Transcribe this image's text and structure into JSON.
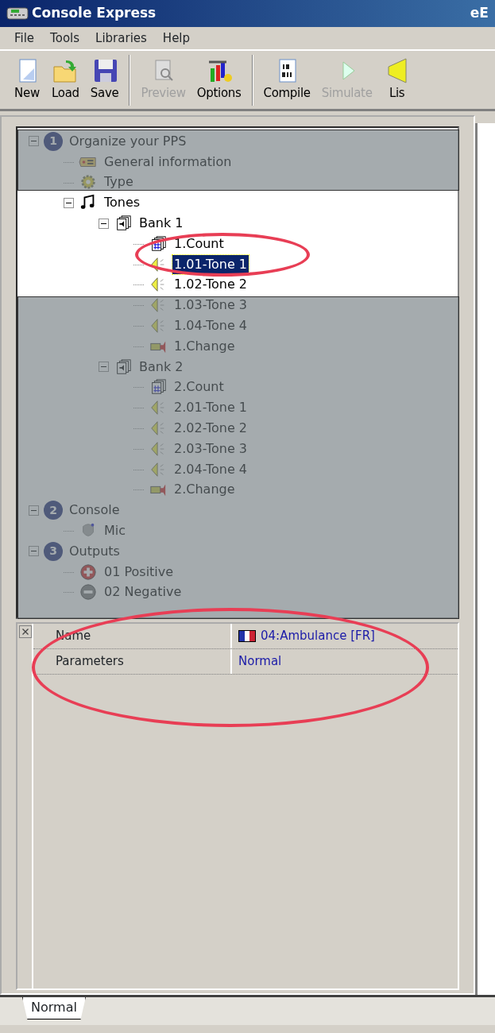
{
  "window": {
    "title": "Console Express",
    "title_right": "eE"
  },
  "menu": [
    "File",
    "Tools",
    "Libraries",
    "Help"
  ],
  "toolbar": [
    {
      "kind": "button",
      "label": "New",
      "disabled": false
    },
    {
      "kind": "button",
      "label": "Load",
      "disabled": false
    },
    {
      "kind": "button",
      "label": "Save",
      "disabled": false
    },
    {
      "kind": "separator"
    },
    {
      "kind": "button",
      "label": "Preview",
      "disabled": true
    },
    {
      "kind": "button",
      "label": "Options",
      "disabled": false
    },
    {
      "kind": "separator"
    },
    {
      "kind": "button",
      "label": "Compile",
      "disabled": false
    },
    {
      "kind": "button",
      "label": "Simulate",
      "disabled": true
    },
    {
      "kind": "button",
      "label": "Lis",
      "disabled": false
    }
  ],
  "tree": [
    {
      "label": "Organize your PPS",
      "kind": "step",
      "badge": "1",
      "expanded": true,
      "selected": false,
      "children": [
        {
          "label": "General  information",
          "kind": "tag",
          "selected": false
        },
        {
          "label": "Type",
          "kind": "gear",
          "selected": false
        },
        {
          "label": "Tones",
          "kind": "note",
          "expanded": true,
          "selected": false,
          "children": [
            {
              "label": "Bank 1",
              "kind": "bank",
              "expanded": true,
              "selected": false,
              "children": [
                {
                  "label": "1.Count",
                  "kind": "count",
                  "selected": false
                },
                {
                  "label": "1.01-Tone 1",
                  "kind": "speaker",
                  "selected": true
                },
                {
                  "label": "1.02-Tone 2",
                  "kind": "speaker",
                  "selected": false
                },
                {
                  "label": "1.03-Tone 3",
                  "kind": "speaker",
                  "selected": false
                },
                {
                  "label": "1.04-Tone 4",
                  "kind": "speaker",
                  "selected": false
                },
                {
                  "label": "1.Change",
                  "kind": "change",
                  "selected": false
                }
              ]
            },
            {
              "label": "Bank 2",
              "kind": "bank",
              "expanded": true,
              "selected": false,
              "children": [
                {
                  "label": "2.Count",
                  "kind": "count",
                  "selected": false
                },
                {
                  "label": "2.01-Tone 1",
                  "kind": "speaker",
                  "selected": false
                },
                {
                  "label": "2.02-Tone 2",
                  "kind": "speaker",
                  "selected": false
                },
                {
                  "label": "2.03-Tone 3",
                  "kind": "speaker",
                  "selected": false
                },
                {
                  "label": "2.04-Tone 4",
                  "kind": "speaker",
                  "selected": false
                },
                {
                  "label": "2.Change",
                  "kind": "change",
                  "selected": false
                }
              ]
            }
          ]
        }
      ]
    },
    {
      "label": "Console",
      "kind": "step",
      "badge": "2",
      "expanded": true,
      "selected": false,
      "children": [
        {
          "label": "Mic",
          "kind": "mic",
          "selected": false
        }
      ]
    },
    {
      "label": "Outputs",
      "kind": "step",
      "badge": "3",
      "expanded": true,
      "selected": false,
      "children": [
        {
          "label": "01 Positive",
          "kind": "plus",
          "selected": false
        },
        {
          "label": "02 Negative",
          "kind": "minus",
          "selected": false
        }
      ]
    }
  ],
  "properties": [
    {
      "name": "Name",
      "value": "04:Ambulance [FR]",
      "flag": true
    },
    {
      "name": "Parameters",
      "value": "Normal",
      "flag": false
    }
  ],
  "tabs": [
    {
      "label": "Normal",
      "selected": true
    }
  ],
  "annotations": [
    {
      "kind": "shade"
    },
    {
      "kind": "shade"
    },
    {
      "kind": "ellipse"
    },
    {
      "kind": "ellipse"
    }
  ]
}
